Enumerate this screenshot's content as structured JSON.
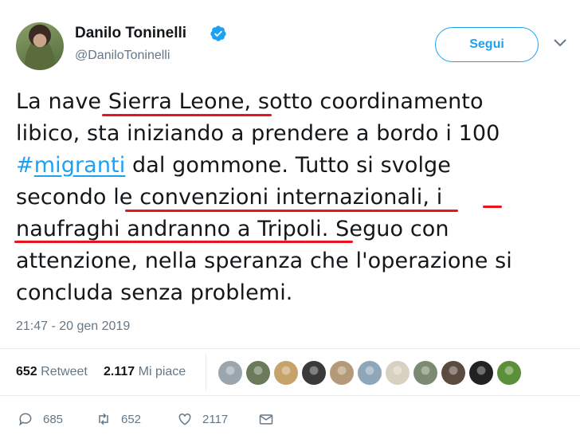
{
  "author": {
    "name": "Danilo Toninelli",
    "handle": "@DaniloToninelli",
    "verified": true
  },
  "follow_label": "Segui",
  "tweet": {
    "lines": [
      [
        "La nave ",
        "Sierra Leone",
        ", sotto coordinamento"
      ],
      [
        "libico, sta iniziando a prendere a bordo i 100"
      ],
      [
        "#",
        "migranti",
        " dal gommone. Tutto si svolge"
      ],
      [
        "secondo ",
        "le convenzioni internazionali",
        ", ",
        "i"
      ],
      [
        "naufraghi andranno a Tripoli",
        ". Seguo con"
      ],
      [
        "attenzione, nella speranza che l'operazione si"
      ],
      [
        "concluda senza problemi."
      ]
    ]
  },
  "timestamp": "21:47 - 20 gen 2019",
  "stats": {
    "retweets_count": "652",
    "retweets_label": "Retweet",
    "likes_count": "2.117",
    "likes_label": "Mi piace"
  },
  "liker_avatars": [
    "#9aa5ae",
    "#6b7a5a",
    "#c6a36a",
    "#3a3a3a",
    "#b59a7a",
    "#8ea6b8",
    "#d8d0c0",
    "#7b8a70",
    "#5a4a40",
    "#222222",
    "#5b8f3a"
  ],
  "actions": {
    "replies": "685",
    "retweets": "652",
    "likes": "2117"
  },
  "colors": {
    "accent": "#1da1f2",
    "underline": "#e8141e",
    "muted": "#657786"
  }
}
